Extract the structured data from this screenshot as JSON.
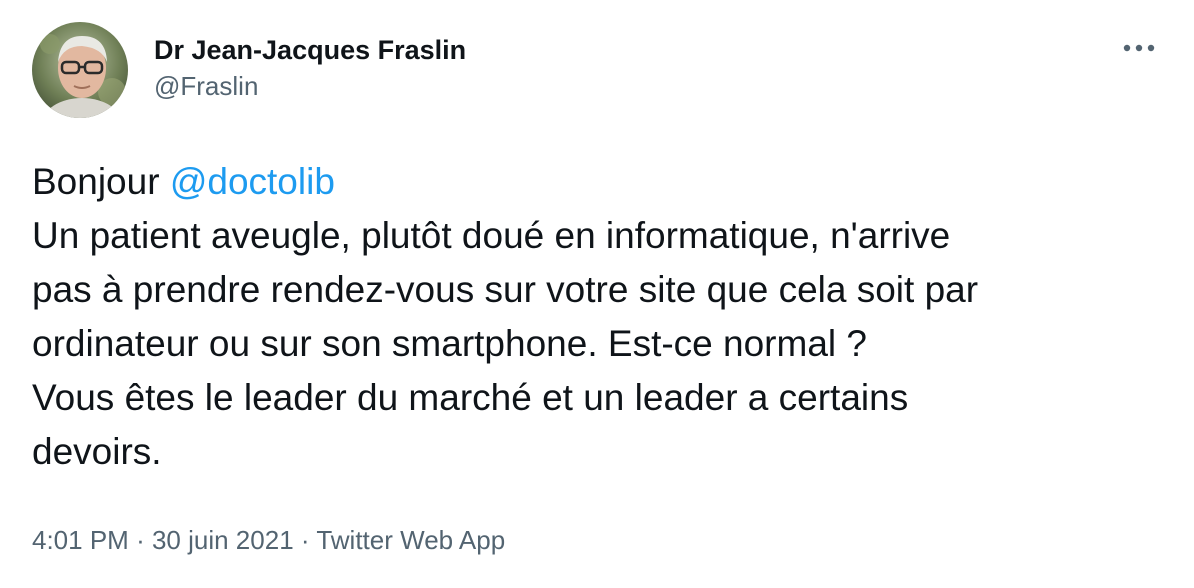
{
  "author": {
    "display_name": "Dr Jean-Jacques Fraslin",
    "handle": "@Fraslin",
    "avatar_icon": "user-avatar-photo"
  },
  "tweet": {
    "greeting": "Bonjour",
    "mention": "@doctolib",
    "lines": [
      "Un patient aveugle, plutôt doué en informatique, n'arrive",
      "pas à prendre rendez-vous sur votre site que cela soit par",
      "ordinateur ou sur son smartphone. Est-ce normal ?",
      "Vous êtes le leader du marché et un leader a certains",
      "devoirs."
    ]
  },
  "meta": {
    "time": "4:01 PM",
    "separator": "·",
    "date": "30 juin 2021",
    "source": "Twitter Web App"
  },
  "icons": {
    "more": "more-horizontal-icon"
  },
  "colors": {
    "text": "#0f1419",
    "secondary": "#536471",
    "link": "#1d9bf0"
  }
}
